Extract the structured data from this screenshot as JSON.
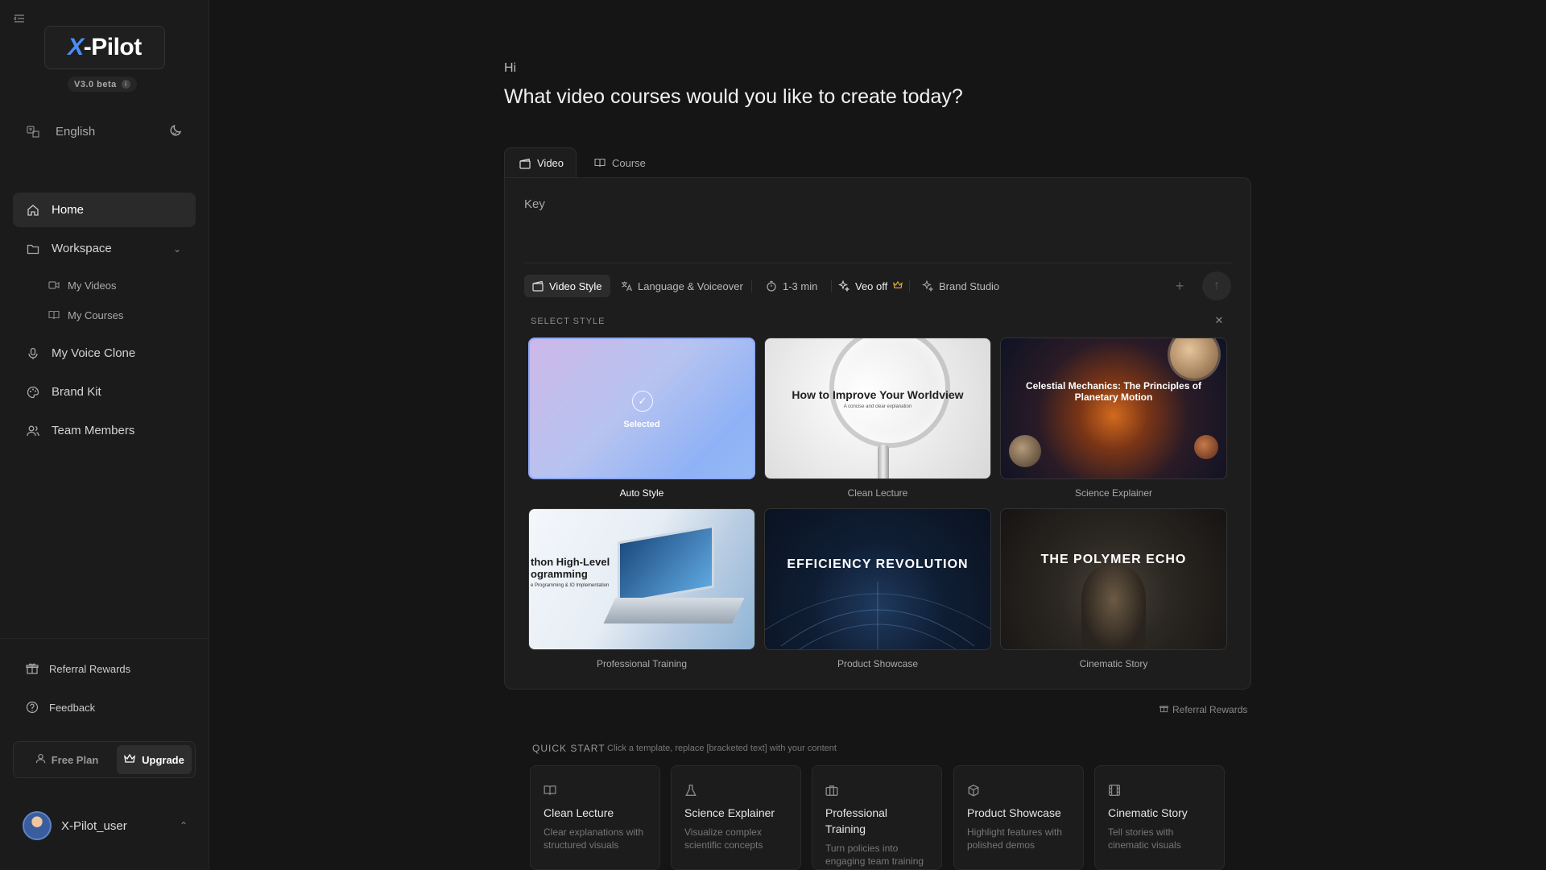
{
  "sidebar": {
    "logo": "X-Pilot",
    "version": "V3.0 beta",
    "language": "English",
    "nav": {
      "home": "Home",
      "workspace": "Workspace",
      "my_videos": "My Videos",
      "my_courses": "My Courses",
      "voice_clone": "My Voice Clone",
      "brand_kit": "Brand Kit",
      "team_members": "Team Members"
    },
    "referral": "Referral Rewards",
    "feedback": "Feedback",
    "plan": "Free Plan",
    "upgrade": "Upgrade",
    "user": "X-Pilot_user"
  },
  "main": {
    "greeting": "Hi",
    "question": "What video courses would you like to create today?",
    "tabs": {
      "video": "Video",
      "course": "Course"
    },
    "input_placeholder": "Key",
    "options": {
      "video_style": "Video Style",
      "language_voiceover": "Language & Voiceover",
      "duration": "1-3 min",
      "veo": "Veo off",
      "brand_studio": "Brand Studio"
    },
    "select_style_title": "SELECT STYLE",
    "styles": [
      {
        "label": "Auto Style",
        "selected_text": "Selected"
      },
      {
        "label": "Clean Lecture",
        "thumb_title": "How to Improve Your Worldview",
        "thumb_sub": "A concise and clear explanation"
      },
      {
        "label": "Science Explainer",
        "thumb_title": "Celestial Mechanics: The Principles of Planetary Motion"
      },
      {
        "label": "Professional Training",
        "thumb_title": "thon High-Level\nogramming",
        "thumb_sub": "e Programming & IO Implementation"
      },
      {
        "label": "Product Showcase",
        "thumb_title": "EFFICIENCY REVOLUTION"
      },
      {
        "label": "Cinematic Story",
        "thumb_title": "THE POLYMER ECHO"
      }
    ],
    "referral_link": "Referral Rewards",
    "quick_start": {
      "title": "QUICK START",
      "hint": "Click a template, replace [bracketed text] with your content",
      "cards": [
        {
          "title": "Clean Lecture",
          "desc": "Clear explanations with structured visuals",
          "icon": "book-icon"
        },
        {
          "title": "Science Explainer",
          "desc": "Visualize complex scientific concepts",
          "icon": "flask-icon"
        },
        {
          "title": "Professional Training",
          "desc": "Turn policies into engaging team training",
          "icon": "briefcase-icon"
        },
        {
          "title": "Product Showcase",
          "desc": "Highlight features with polished demos",
          "icon": "package-icon"
        },
        {
          "title": "Cinematic Story",
          "desc": "Tell stories with cinematic visuals",
          "icon": "film-icon"
        }
      ]
    }
  },
  "colors": {
    "accent": "#4b8df8",
    "crown": "#e0a93a",
    "background": "#151515",
    "panel": "#1d1d1d"
  }
}
